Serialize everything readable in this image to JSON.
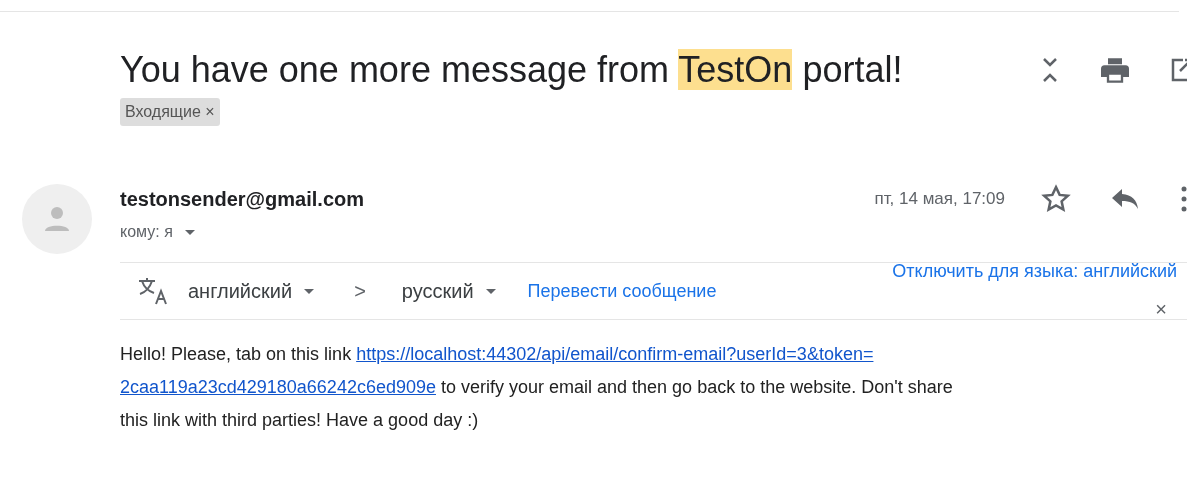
{
  "subject": {
    "parts": [
      {
        "text": "You have one more message from ",
        "highlight": false
      },
      {
        "text": "TestOn",
        "highlight": true
      },
      {
        "text": " portal!",
        "highlight": false
      }
    ]
  },
  "labels": [
    {
      "text": "Входящие",
      "close": "×"
    }
  ],
  "sender": {
    "email": "testonsender@gmail.com",
    "to": "кому: я",
    "date": "пт, 14 мая, 17:09",
    "starred": false
  },
  "translate": {
    "from": "английский",
    "arrow": ">",
    "to": "русский",
    "action": "Перевести сообщение",
    "disable": "Отключить для языка: английский",
    "close": "×"
  },
  "body": {
    "lines": [
      [
        {
          "text": "Hello! Please, tab on this link ",
          "link": false
        },
        {
          "text": "https://localhost:44302/api/email/confirm-email?userId=3&token=",
          "link": true
        }
      ],
      [
        {
          "text": "2caa119a23cd429180a66242c6ed909e",
          "link": true
        },
        {
          "text": " to verify your email and then go back to the website. Don't share",
          "link": false
        }
      ],
      [
        {
          "text": "this link with third parties! Have a good day :)",
          "link": false
        }
      ]
    ]
  }
}
